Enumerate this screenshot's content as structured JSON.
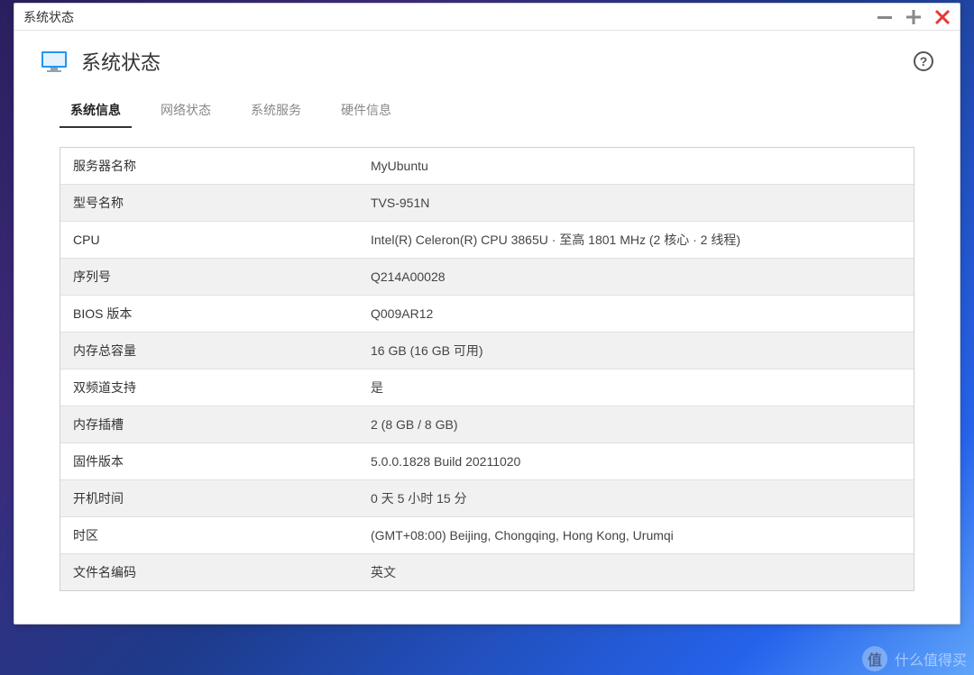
{
  "window": {
    "title": "系统状态"
  },
  "header": {
    "title": "系统状态"
  },
  "tabs": {
    "t0": "系统信息",
    "t1": "网络状态",
    "t2": "系统服务",
    "t3": "硬件信息",
    "activeIndex": 0
  },
  "info": [
    {
      "label": "服务器名称",
      "value": "MyUbuntu"
    },
    {
      "label": "型号名称",
      "value": "TVS-951N"
    },
    {
      "label": "CPU",
      "value": "Intel(R) Celeron(R) CPU 3865U  · 至高 1801 MHz (2 核心 · 2 线程)"
    },
    {
      "label": "序列号",
      "value": "Q214A00028"
    },
    {
      "label": "BIOS 版本",
      "value": "Q009AR12"
    },
    {
      "label": "内存总容量",
      "value": "16 GB (16 GB 可用)"
    },
    {
      "label": "双频道支持",
      "value": "是"
    },
    {
      "label": "内存插槽",
      "value": "2 (8 GB / 8 GB)"
    },
    {
      "label": "固件版本",
      "value": "5.0.0.1828 Build 20211020"
    },
    {
      "label": "开机时间",
      "value": "0 天 5 小时 15 分"
    },
    {
      "label": "时区",
      "value": "(GMT+08:00) Beijing, Chongqing, Hong Kong, Urumqi"
    },
    {
      "label": "文件名编码",
      "value": "英文"
    }
  ],
  "watermark": {
    "text": "什么值得买",
    "badge": "值"
  }
}
